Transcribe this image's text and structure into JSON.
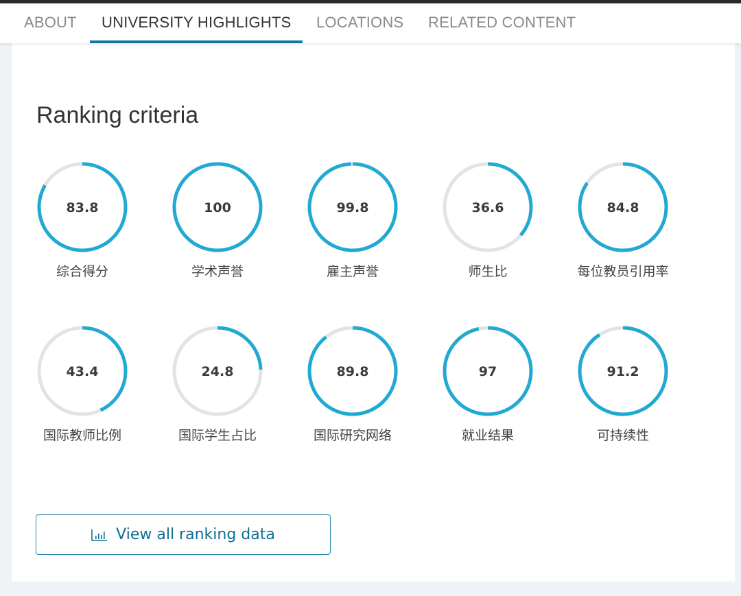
{
  "tabs": [
    {
      "label": "ABOUT",
      "active": false
    },
    {
      "label": "UNIVERSITY HIGHLIGHTS",
      "active": true
    },
    {
      "label": "LOCATIONS",
      "active": false
    },
    {
      "label": "RELATED CONTENT",
      "active": false
    }
  ],
  "section": {
    "title": "Ranking criteria"
  },
  "colors": {
    "accent": "#22a9d3",
    "track": "#e3e3e6",
    "tab_underline": "#0f7aa3",
    "button_text": "#0f6e94"
  },
  "criteria": [
    {
      "label": "综合得分",
      "value": "83.8",
      "score": 83.8
    },
    {
      "label": "学术声誉",
      "value": "100",
      "score": 100
    },
    {
      "label": "雇主声誉",
      "value": "99.8",
      "score": 99.8
    },
    {
      "label": "师生比",
      "value": "36.6",
      "score": 36.6
    },
    {
      "label": "每位教员引用率",
      "value": "84.8",
      "score": 84.8
    },
    {
      "label": "国际教师比例",
      "value": "43.4",
      "score": 43.4
    },
    {
      "label": "国际学生占比",
      "value": "24.8",
      "score": 24.8
    },
    {
      "label": "国际研究网络",
      "value": "89.8",
      "score": 89.8
    },
    {
      "label": "就业结果",
      "value": "97",
      "score": 97
    },
    {
      "label": "可持续性",
      "value": "91.2",
      "score": 91.2
    }
  ],
  "button": {
    "label": "View all ranking data",
    "icon": "bar-chart-icon"
  }
}
